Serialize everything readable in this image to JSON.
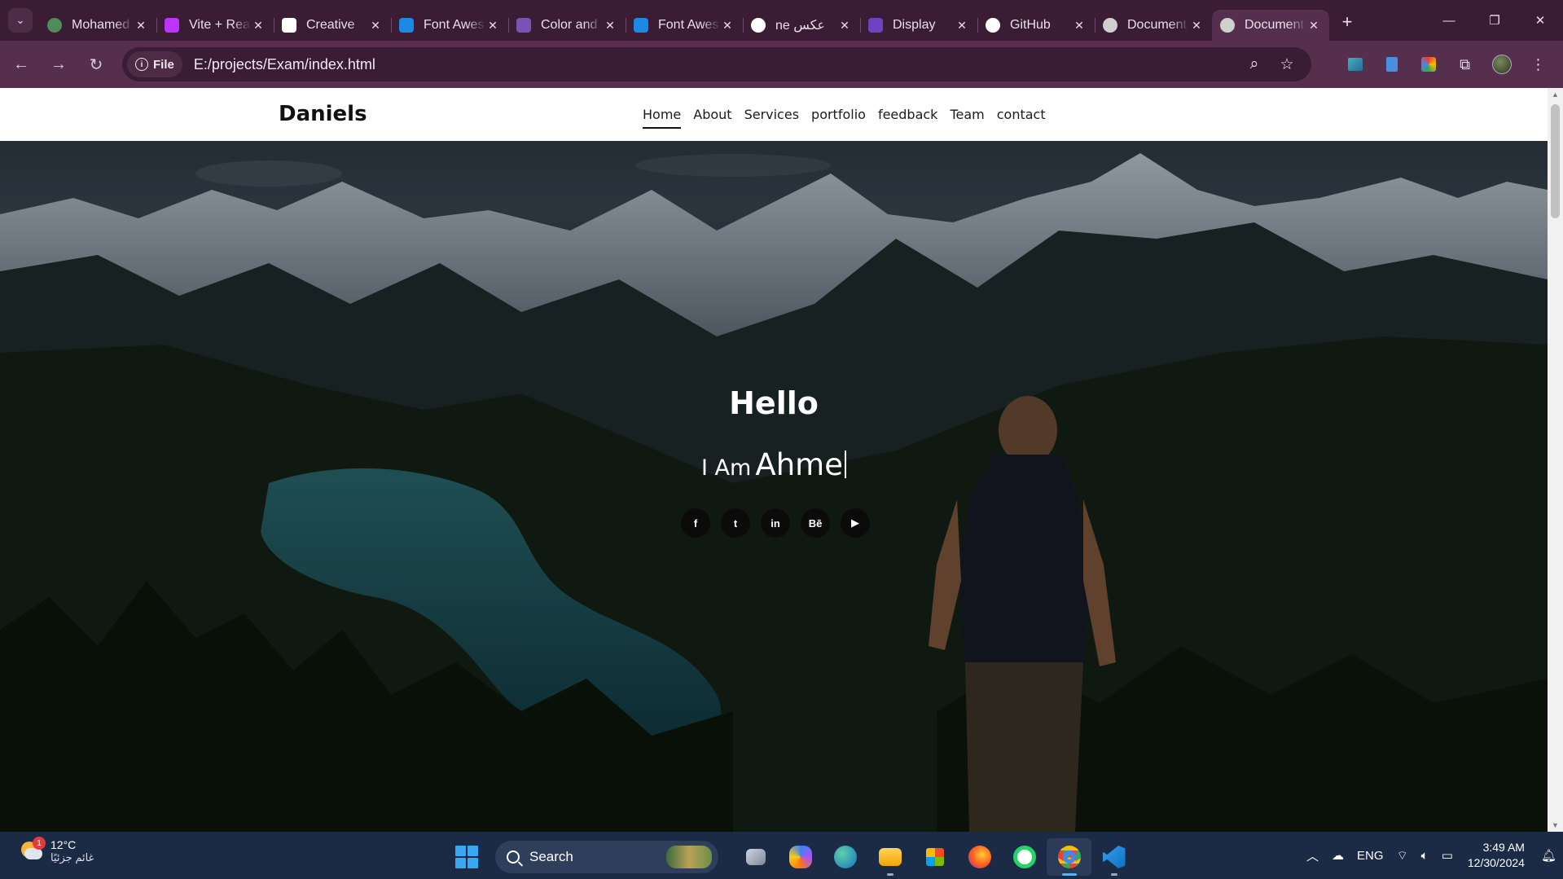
{
  "browser": {
    "tabs": [
      {
        "title": "Mohamed",
        "icon": "profile-icon",
        "color": "#4e8d5b"
      },
      {
        "title": "Vite + React",
        "icon": "vite-icon",
        "color": "#bd34fe"
      },
      {
        "title": "Creative",
        "icon": "sparkle-icon",
        "color": "#ffffff"
      },
      {
        "title": "Font Awesome",
        "icon": "flag-icon",
        "color": "#1e88e5"
      },
      {
        "title": "Color and",
        "icon": "bootstrap-icon",
        "color": "#7952b3"
      },
      {
        "title": "Font Awesome",
        "icon": "flag-icon",
        "color": "#1e88e5"
      },
      {
        "title": "ne عكس",
        "icon": "google-icon",
        "color": "#ffffff"
      },
      {
        "title": "Display",
        "icon": "bootstrap-icon",
        "color": "#6f42c1"
      },
      {
        "title": "GitHub",
        "icon": "github-icon",
        "color": "#ffffff"
      },
      {
        "title": "Document",
        "icon": "globe-icon",
        "color": "#cfcfcf"
      },
      {
        "title": "Document",
        "icon": "globe-icon",
        "color": "#cfcfcf",
        "active": true
      }
    ],
    "new_tab": "+",
    "site_info": "File",
    "url": "E:/projects/Exam/index.html"
  },
  "page": {
    "brand": "Daniels",
    "nav": [
      "Home",
      "About",
      "Services",
      "portfolio",
      "feedback",
      "Team",
      "contact"
    ],
    "active_nav": "Home",
    "hero": {
      "title": "Hello",
      "lead": "I Am",
      "typed": "Ahme"
    },
    "socials": [
      {
        "name": "facebook-icon",
        "glyph": "f"
      },
      {
        "name": "twitter-icon",
        "glyph": "t"
      },
      {
        "name": "linkedin-icon",
        "glyph": "in"
      },
      {
        "name": "behance-icon",
        "glyph": "Bē"
      },
      {
        "name": "youtube-icon",
        "glyph": "▶"
      }
    ]
  },
  "taskbar": {
    "weather_badge": "1",
    "temperature": "12°C",
    "weather_desc": "غائم جزئيًا",
    "search": "Search",
    "language": "ENG",
    "time": "3:49 AM",
    "date": "12/30/2024"
  }
}
